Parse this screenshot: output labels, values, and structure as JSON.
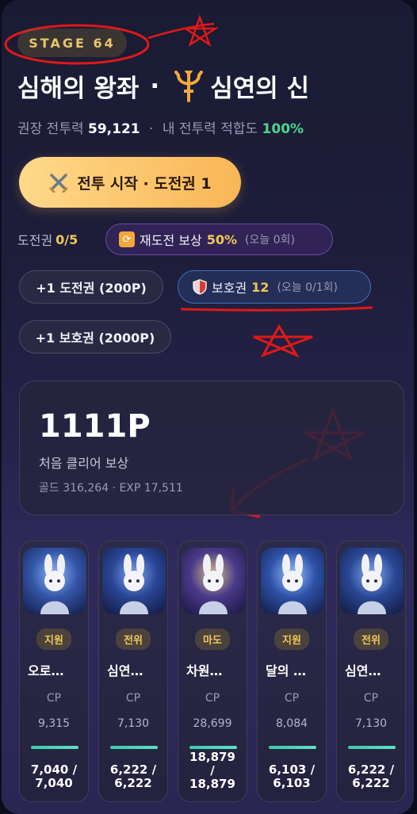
{
  "stage": {
    "label": "STAGE 64"
  },
  "title": {
    "left": "심해의 왕좌",
    "separator": "·",
    "right": "심연의 신"
  },
  "power": {
    "recommended_label": "권장 전투력",
    "recommended_value": "59,121",
    "separator": "·",
    "fit_label": "내 전투력 적합도",
    "fit_value": "100%"
  },
  "start_button": {
    "label": "전투 시작 · 도전권 1"
  },
  "tickets": {
    "label": "도전권",
    "value": "0/5",
    "retry_label": "재도전 보상",
    "retry_value": "50%",
    "retry_note": "(오늘 0회)"
  },
  "buy_buttons": {
    "ticket": "+1 도전권 (200P)",
    "shield": "+1 보호권 (2000P)"
  },
  "shield": {
    "label": "보호권",
    "value": "12",
    "note": "(오늘 0/1회)"
  },
  "reward": {
    "points": "1111P",
    "label": "처음 클리어 보상",
    "details": "골드 316,264 · EXP 17,511"
  },
  "party": [
    {
      "role": "지원",
      "name": "오로…",
      "cp_label": "CP",
      "cp": "9,315",
      "hp": "7,040 / 7,040",
      "hp_fraction": 1.0
    },
    {
      "role": "전위",
      "name": "심연…",
      "cp_label": "CP",
      "cp": "7,130",
      "hp": "6,222 / 6,222",
      "hp_fraction": 1.0
    },
    {
      "role": "마도",
      "name": "차원…",
      "cp_label": "CP",
      "cp": "28,699",
      "hp": "18,879 / 18,879",
      "hp_fraction": 1.0
    },
    {
      "role": "지원",
      "name": "달의 …",
      "cp_label": "CP",
      "cp": "8,084",
      "hp": "6,103 / 6,103",
      "hp_fraction": 1.0
    },
    {
      "role": "전위",
      "name": "심연…",
      "cp_label": "CP",
      "cp": "7,130",
      "hp": "6,222 / 6,222",
      "hp_fraction": 1.0
    }
  ],
  "colors": {
    "accent_gold": "#f0c85a",
    "fit_green": "#4cd48a",
    "hp_teal": "#3ec9b0",
    "annotation_red": "#e01818"
  },
  "icons": {
    "title": "trident-icon",
    "start": "crossed-swords-icon",
    "retry": "refresh-icon",
    "shield": "shield-icon"
  }
}
